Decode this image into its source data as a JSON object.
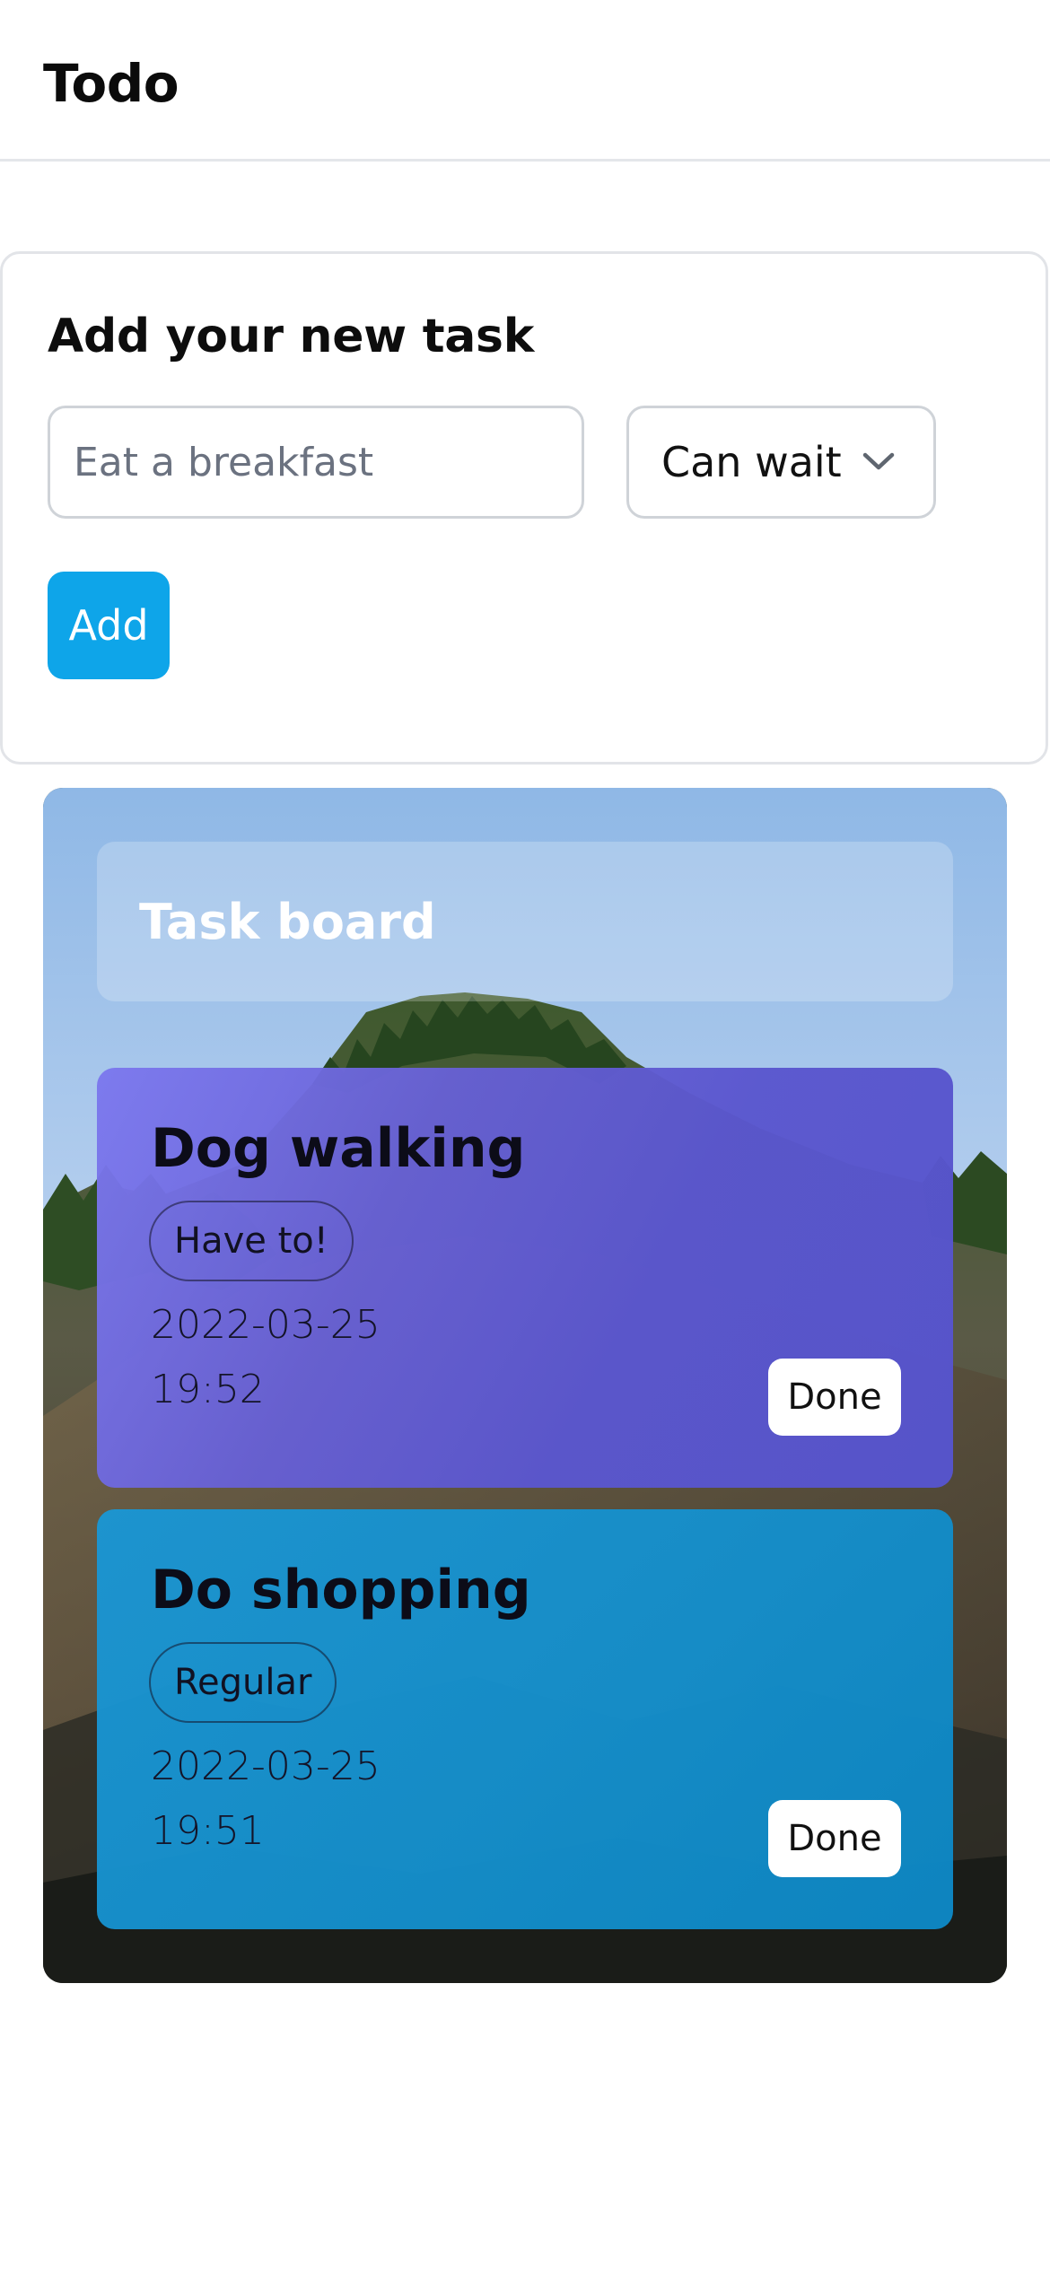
{
  "header": {
    "title": "Todo"
  },
  "add_task": {
    "heading": "Add your new task",
    "input_value": "",
    "input_placeholder": "Eat a breakfast",
    "priority_selected": "Can wait",
    "add_label": "Add"
  },
  "board": {
    "title": "Task board",
    "tasks": [
      {
        "title": "Dog walking",
        "priority": "Have to!",
        "date": "2022-03-25",
        "time": "19:52",
        "done_label": "Done"
      },
      {
        "title": "Do shopping",
        "priority": "Regular",
        "date": "2022-03-25",
        "time": "19:51",
        "done_label": "Done"
      }
    ]
  },
  "icons": {
    "select_caret": "chevron-down-icon",
    "board_background": "mountain-landscape-image"
  },
  "colors": {
    "accent": "#0ea5e9",
    "card_have_to": "#5b57cf",
    "card_regular": "#1590cc"
  }
}
